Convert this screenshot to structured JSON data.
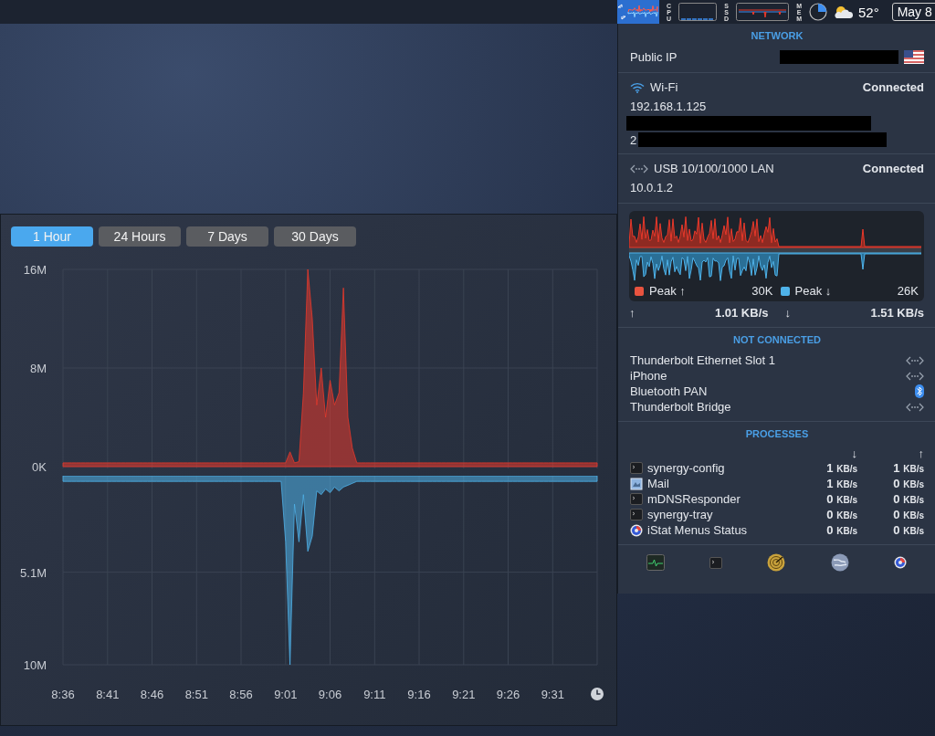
{
  "menu_bar": {
    "cpu_label": "CPU",
    "ssd_label": "SSD",
    "mem_label": "MEM",
    "temperature": "52°",
    "date": "May 8"
  },
  "network_popup": {
    "network_header": "NETWORK",
    "public_ip": {
      "label": "Public IP"
    },
    "interfaces": [
      {
        "kind": "wifi",
        "name": "Wi-Fi",
        "status": "Connected",
        "ipv4": "192.168.1.125",
        "ipv6_prefix": "2"
      },
      {
        "kind": "ethernet",
        "name": "USB 10/100/1000 LAN",
        "status": "Connected",
        "ipv4": "10.0.1.2"
      }
    ],
    "legend": [
      {
        "label": "Peak ↑",
        "value": "30K",
        "color": "#e8533f"
      },
      {
        "label": "Peak ↓",
        "value": "26K",
        "color": "#4fb3ea"
      }
    ],
    "rates": [
      {
        "arrow": "↑",
        "value": "1.01 KB/s"
      },
      {
        "arrow": "↓",
        "value": "1.51 KB/s"
      }
    ],
    "not_connected_header": "NOT CONNECTED",
    "not_connected": [
      {
        "name": "Thunderbolt Ethernet Slot 1",
        "kind": "ethernet"
      },
      {
        "name": "iPhone",
        "kind": "ethernet"
      },
      {
        "name": "Bluetooth PAN",
        "kind": "bluetooth"
      },
      {
        "name": "Thunderbolt Bridge",
        "kind": "ethernet"
      }
    ],
    "processes_header": "PROCESSES",
    "process_columns": [
      "↓",
      "↑"
    ],
    "processes": [
      {
        "name": "synergy-config",
        "kind": "terminal",
        "down": {
          "value": "1",
          "unit": "KB/s"
        },
        "up": {
          "value": "1",
          "unit": "KB/s"
        }
      },
      {
        "name": "Mail",
        "kind": "mail",
        "down": {
          "value": "1",
          "unit": "KB/s"
        },
        "up": {
          "value": "0",
          "unit": "KB/s"
        }
      },
      {
        "name": "mDNSResponder",
        "kind": "terminal",
        "down": {
          "value": "0",
          "unit": "KB/s"
        },
        "up": {
          "value": "0",
          "unit": "KB/s"
        }
      },
      {
        "name": "synergy-tray",
        "kind": "terminal",
        "down": {
          "value": "0",
          "unit": "KB/s"
        },
        "up": {
          "value": "0",
          "unit": "KB/s"
        }
      },
      {
        "name": "iStat Menus Status",
        "kind": "istat",
        "down": {
          "value": "0",
          "unit": "KB/s"
        },
        "up": {
          "value": "0",
          "unit": "KB/s"
        }
      }
    ],
    "toolbar": [
      {
        "kind": "activity"
      },
      {
        "kind": "terminal"
      },
      {
        "kind": "radar"
      },
      {
        "kind": "globe"
      },
      {
        "kind": "istat"
      }
    ]
  },
  "history_window": {
    "ranges": [
      {
        "label": "1 Hour",
        "selected": true
      },
      {
        "label": "24 Hours",
        "selected": false
      },
      {
        "label": "7 Days",
        "selected": false
      },
      {
        "label": "30 Days",
        "selected": false
      }
    ],
    "upload_chart": {
      "chart_data": {
        "type": "area",
        "grid": true,
        "series": [
          {
            "color": "#e8392b",
            "values": [
              0.3,
              0.3,
              0.3,
              0.3,
              0.3,
              0.3,
              0.3,
              0.3,
              0.3,
              0.3,
              0.3,
              0.3,
              0.3,
              0.3,
              0.3,
              0.3,
              0.3,
              0.3,
              0.3,
              0.3,
              0.3,
              0.3,
              0.3,
              0.3,
              0.3,
              0.3,
              0.3,
              0.3,
              0.3,
              0.3,
              0.3,
              0.3,
              0.3,
              0.3,
              0.3,
              0.3,
              0.3,
              0.3,
              0.3,
              0.3,
              0.3,
              0.3,
              0.3,
              0.3,
              0.3,
              0.3,
              0.3,
              0.3,
              0.3,
              0.3,
              0.3,
              1.2,
              0.3,
              0.4,
              6,
              16,
              12,
              5,
              8,
              4,
              7,
              5,
              6,
              14.5,
              4,
              1.5,
              0.3,
              0.3,
              0.3,
              0.3,
              0.3,
              0.3,
              0.3,
              0.3,
              0.3,
              0.3,
              0.3,
              0.3,
              0.3,
              0.3,
              0.3,
              0.3,
              0.3,
              0.3,
              0.3,
              0.3,
              0.3,
              0.3,
              0.3,
              0.3,
              0.3,
              0.3,
              0.3,
              0.3,
              0.3,
              0.3,
              0.3,
              0.3,
              0.3,
              0.3,
              0.3,
              0.3,
              0.3,
              0.3,
              0.3,
              0.3,
              0.3,
              0.3,
              0.3,
              0.3,
              0.3,
              0.3,
              0.3,
              0.3,
              0.3,
              0.3,
              0.3,
              0.3,
              0.3,
              0.3,
              0.3
            ]
          }
        ],
        "ylim": [
          0,
          16
        ],
        "yticks": [
          {
            "value": 16,
            "label": "16M"
          },
          {
            "value": 8,
            "label": "8M"
          },
          {
            "value": 0,
            "label": "0K"
          }
        ]
      }
    },
    "download_chart": {
      "chart_data": {
        "type": "area",
        "grid": true,
        "categories": [
          "8:36",
          null,
          null,
          null,
          null,
          null,
          null,
          null,
          null,
          null,
          "8:41",
          null,
          null,
          null,
          null,
          null,
          null,
          null,
          null,
          null,
          "8:46",
          null,
          null,
          null,
          null,
          null,
          null,
          null,
          null,
          null,
          "8:51",
          null,
          null,
          null,
          null,
          null,
          null,
          null,
          null,
          null,
          "8:56",
          null,
          null,
          null,
          null,
          null,
          null,
          null,
          null,
          null,
          "9:01",
          null,
          null,
          null,
          null,
          null,
          null,
          null,
          null,
          null,
          "9:06",
          null,
          null,
          null,
          null,
          null,
          null,
          null,
          null,
          null,
          "9:11",
          null,
          null,
          null,
          null,
          null,
          null,
          null,
          null,
          null,
          "9:16",
          null,
          null,
          null,
          null,
          null,
          null,
          null,
          null,
          null,
          "9:21",
          null,
          null,
          null,
          null,
          null,
          null,
          null,
          null,
          null,
          "9:26",
          null,
          null,
          null,
          null,
          null,
          null,
          null,
          null,
          null,
          "9:31",
          null,
          null,
          null,
          null,
          null,
          null,
          null,
          null,
          null,
          null
        ],
        "series": [
          {
            "color": "#4fb3ea",
            "values": [
              0.3,
              0.3,
              0.3,
              0.3,
              0.3,
              0.3,
              0.3,
              0.3,
              0.3,
              0.3,
              0.3,
              0.3,
              0.3,
              0.3,
              0.3,
              0.3,
              0.3,
              0.3,
              0.3,
              0.3,
              0.3,
              0.3,
              0.3,
              0.3,
              0.3,
              0.3,
              0.3,
              0.3,
              0.3,
              0.3,
              0.3,
              0.3,
              0.3,
              0.3,
              0.3,
              0.3,
              0.3,
              0.3,
              0.3,
              0.3,
              0.3,
              0.3,
              0.3,
              0.3,
              0.3,
              0.3,
              0.3,
              0.3,
              0.3,
              0.3,
              3.5,
              10,
              1.5,
              3.5,
              1,
              4,
              3.2,
              0.8,
              1,
              0.7,
              0.9,
              0.6,
              0.8,
              0.6,
              0.5,
              0.4,
              0.3,
              0.3,
              0.3,
              0.3,
              0.3,
              0.3,
              0.3,
              0.3,
              0.3,
              0.3,
              0.3,
              0.3,
              0.3,
              0.3,
              0.3,
              0.3,
              0.3,
              0.3,
              0.3,
              0.3,
              0.3,
              0.3,
              0.3,
              0.3,
              0.3,
              0.3,
              0.3,
              0.3,
              0.3,
              0.3,
              0.3,
              0.3,
              0.3,
              0.3,
              0.3,
              0.3,
              0.3,
              0.3,
              0.3,
              0.3,
              0.3,
              0.3,
              0.3,
              0.3,
              0.3,
              0.3,
              0.3,
              0.3,
              0.3,
              0.3,
              0.3,
              0.3,
              0.3,
              0.3,
              0.3
            ]
          }
        ],
        "ylim": [
          10,
          0
        ],
        "yticks": [
          {
            "value": 5.1,
            "label": "5.1M"
          },
          {
            "value": 10,
            "label": "10M"
          }
        ]
      }
    }
  }
}
